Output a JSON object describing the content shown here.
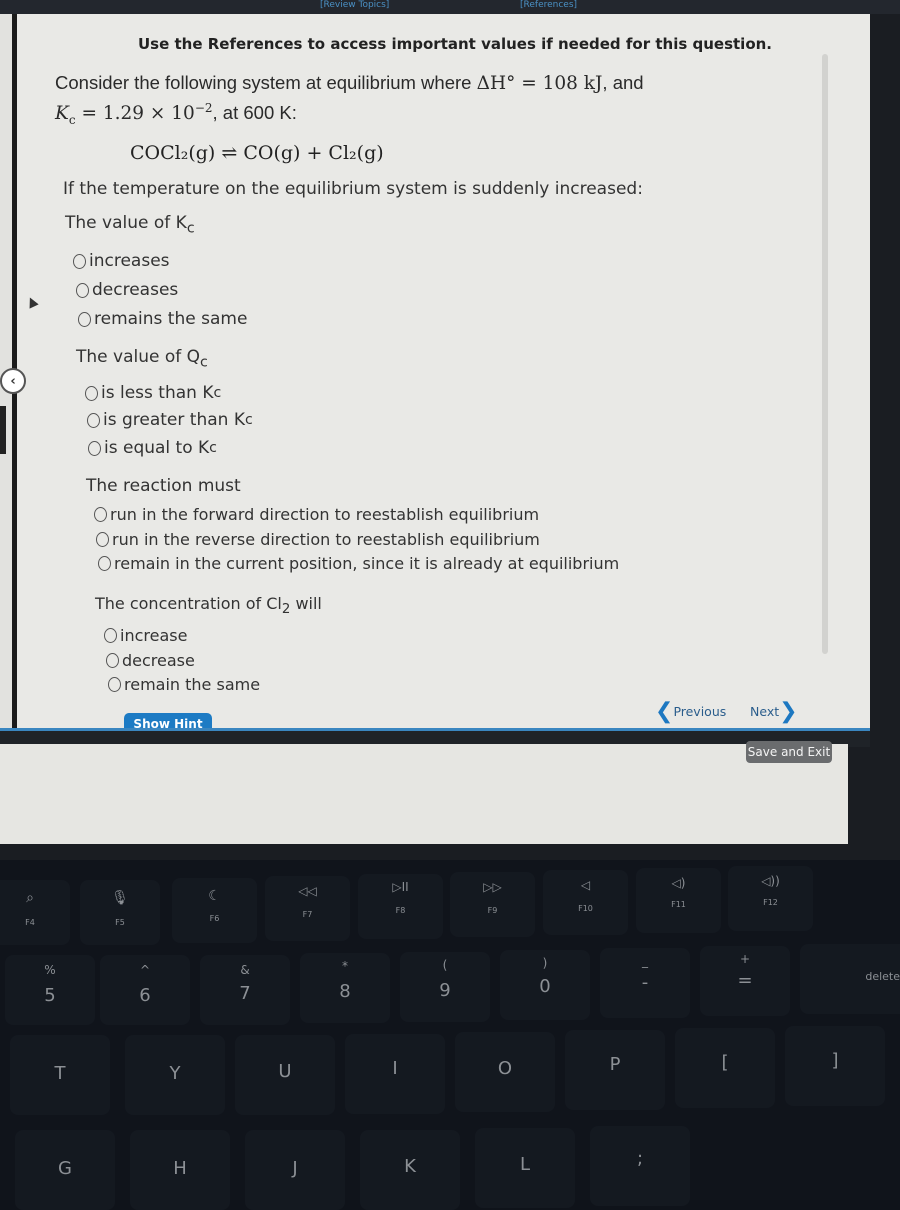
{
  "top_tabs": [
    "[Review Topics]",
    "[References]"
  ],
  "reference_note": "Use the References to access important values if needed for this question.",
  "intro": {
    "line1_prefix": "Consider the following system at equilibrium where ",
    "delta_h": "ΔH° = 108 kJ",
    "line1_suffix": ", and",
    "kc_label": "K",
    "kc_sub": "c",
    "kc_value": " = 1.29 × 10",
    "kc_exp": "−2",
    "line2_suffix": ", at 600 K:"
  },
  "equation": "COCl₂(g) ⇌ CO(g) + Cl₂(g)",
  "prompt": "If the temperature on the equilibrium system is suddenly increased:",
  "questions": [
    {
      "label": "The value of K",
      "label_sub": "c",
      "options": [
        "increases",
        "decreases",
        "remains the same"
      ]
    },
    {
      "label": "The value of Q",
      "label_sub": "c",
      "options": [
        "is less than K",
        "is greater than K",
        "is equal to K"
      ],
      "option_sub": "c"
    },
    {
      "label": "The reaction must",
      "options": [
        "run in the forward direction to reestablish equilibrium",
        "run in the reverse direction to reestablish equilibrium",
        "remain in the current position, since it is already at equilibrium"
      ]
    },
    {
      "label": "The concentration of Cl",
      "label_sub": "2",
      "label_suffix": " will",
      "options": [
        "increase",
        "decrease",
        "remain the same"
      ]
    }
  ],
  "buttons": {
    "show_hint": "Show Hint",
    "previous": "Previous",
    "next": "Next",
    "save_exit": "Save and Exit"
  },
  "keyboard": {
    "fn_row": [
      {
        "icon": "search-icon",
        "glyph": "⌕",
        "label": "F4"
      },
      {
        "icon": "microphone-icon",
        "glyph": "🎙",
        "label": "F5"
      },
      {
        "icon": "moon-icon",
        "glyph": "☾",
        "label": "F6"
      },
      {
        "icon": "rewind-icon",
        "glyph": "◁◁",
        "label": "F7"
      },
      {
        "icon": "play-pause-icon",
        "glyph": "▷II",
        "label": "F8"
      },
      {
        "icon": "fast-forward-icon",
        "glyph": "▷▷",
        "label": "F9"
      },
      {
        "icon": "mute-icon",
        "glyph": "◁",
        "label": "F10"
      },
      {
        "icon": "volume-down-icon",
        "glyph": "◁)",
        "label": "F11"
      },
      {
        "icon": "volume-up-icon",
        "glyph": "◁))",
        "label": "F12"
      }
    ],
    "num_row": [
      {
        "main": "5",
        "shift": "%"
      },
      {
        "main": "6",
        "shift": "^"
      },
      {
        "main": "7",
        "shift": "&"
      },
      {
        "main": "8",
        "shift": "*"
      },
      {
        "main": "9",
        "shift": "("
      },
      {
        "main": "0",
        "shift": ")"
      },
      {
        "main": "-",
        "shift": "_"
      },
      {
        "main": "=",
        "shift": "+"
      },
      {
        "main": "delete",
        "shift": ""
      }
    ],
    "top_row": [
      "T",
      "Y",
      "U",
      "I",
      "O",
      "P",
      "[",
      "]"
    ],
    "home_row": [
      "G",
      "H",
      "J",
      "K",
      "L",
      ";"
    ]
  }
}
